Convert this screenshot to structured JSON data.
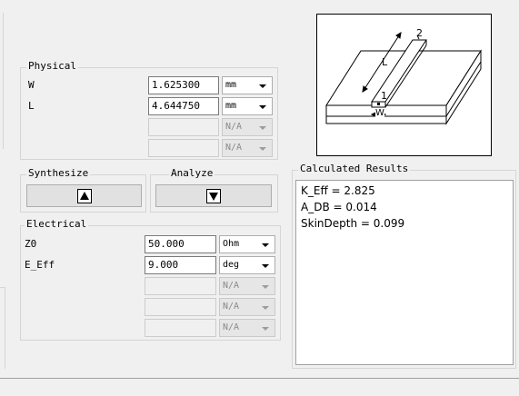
{
  "physical": {
    "title": "Physical",
    "rows": [
      {
        "label": "W",
        "value": "1.625300",
        "unit": "mm"
      },
      {
        "label": "L",
        "value": "4.644750",
        "unit": "mm"
      },
      {
        "label": "",
        "value": "",
        "unit": "N/A"
      },
      {
        "label": "",
        "value": "",
        "unit": "N/A"
      }
    ]
  },
  "synthesize": {
    "title": "Synthesize",
    "icon": "up-triangle-icon"
  },
  "analyze": {
    "title": "Analyze",
    "icon": "down-triangle-icon"
  },
  "electrical": {
    "title": "Electrical",
    "rows": [
      {
        "label": "Z0",
        "value": "50.000",
        "unit": "Ohm"
      },
      {
        "label": "E_Eff",
        "value": "9.000",
        "unit": "deg"
      },
      {
        "label": "",
        "value": "",
        "unit": "N/A"
      },
      {
        "label": "",
        "value": "",
        "unit": "N/A"
      },
      {
        "label": "",
        "value": "",
        "unit": "N/A"
      }
    ]
  },
  "results": {
    "title": "Calculated Results",
    "lines": [
      "K_Eff = 2.825",
      "A_DB = 0.014",
      "SkinDepth = 0.099"
    ]
  },
  "diagram": {
    "labels": {
      "port1": "1",
      "port2": "2",
      "length": "L",
      "width": "W"
    }
  }
}
